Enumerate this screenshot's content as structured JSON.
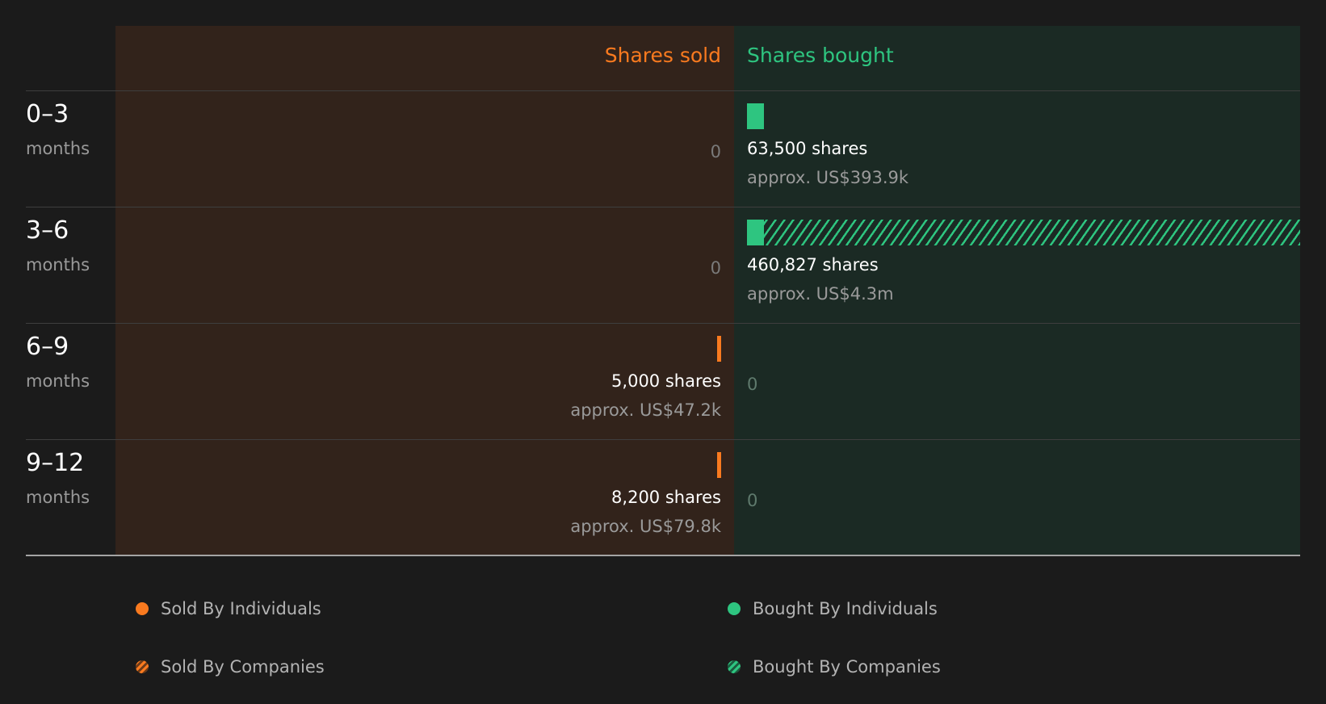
{
  "chart_data": {
    "type": "bar",
    "layout": "diverging-horizontal",
    "headers": {
      "sold": "Shares sold",
      "bought": "Shares bought"
    },
    "categories": [
      {
        "range": "0–3",
        "unit": "months"
      },
      {
        "range": "3–6",
        "unit": "months"
      },
      {
        "range": "6–9",
        "unit": "months"
      },
      {
        "range": "9–12",
        "unit": "months"
      }
    ],
    "series": [
      {
        "name": "Sold By Individuals",
        "side": "sold",
        "values": [
          0,
          0,
          5000,
          8200
        ]
      },
      {
        "name": "Sold By Companies",
        "side": "sold",
        "values": [
          0,
          0,
          0,
          0
        ]
      },
      {
        "name": "Bought By Individuals",
        "side": "bought",
        "values": [
          63500,
          13000,
          0,
          0
        ]
      },
      {
        "name": "Bought By Companies",
        "side": "bought",
        "values": [
          0,
          447827,
          0,
          0
        ]
      }
    ],
    "labels": {
      "sold": [
        {
          "shares": "0",
          "value": ""
        },
        {
          "shares": "0",
          "value": ""
        },
        {
          "shares": "5,000 shares",
          "value": "approx. US$47.2k"
        },
        {
          "shares": "8,200 shares",
          "value": "approx. US$79.8k"
        }
      ],
      "bought": [
        {
          "shares": "63,500 shares",
          "value": "approx. US$393.9k"
        },
        {
          "shares": "460,827 shares",
          "value": "approx. US$4.3m"
        },
        {
          "shares": "0",
          "value": ""
        },
        {
          "shares": "0",
          "value": ""
        }
      ]
    },
    "legend": {
      "placement": "bottom",
      "items": [
        {
          "label": "Sold By Individuals",
          "style": "solid",
          "side": "sold"
        },
        {
          "label": "Bought By Individuals",
          "style": "solid",
          "side": "bought"
        },
        {
          "label": "Sold By Companies",
          "style": "hatched",
          "side": "sold"
        },
        {
          "label": "Bought By Companies",
          "style": "hatched",
          "side": "bought"
        }
      ]
    },
    "scale_max_shares": 400000,
    "colors": {
      "sold": "#f97a1f",
      "bought": "#2ec580",
      "sold_bg": "#32231b",
      "bought_bg": "#1b2a24",
      "background": "#1b1b1b"
    }
  }
}
